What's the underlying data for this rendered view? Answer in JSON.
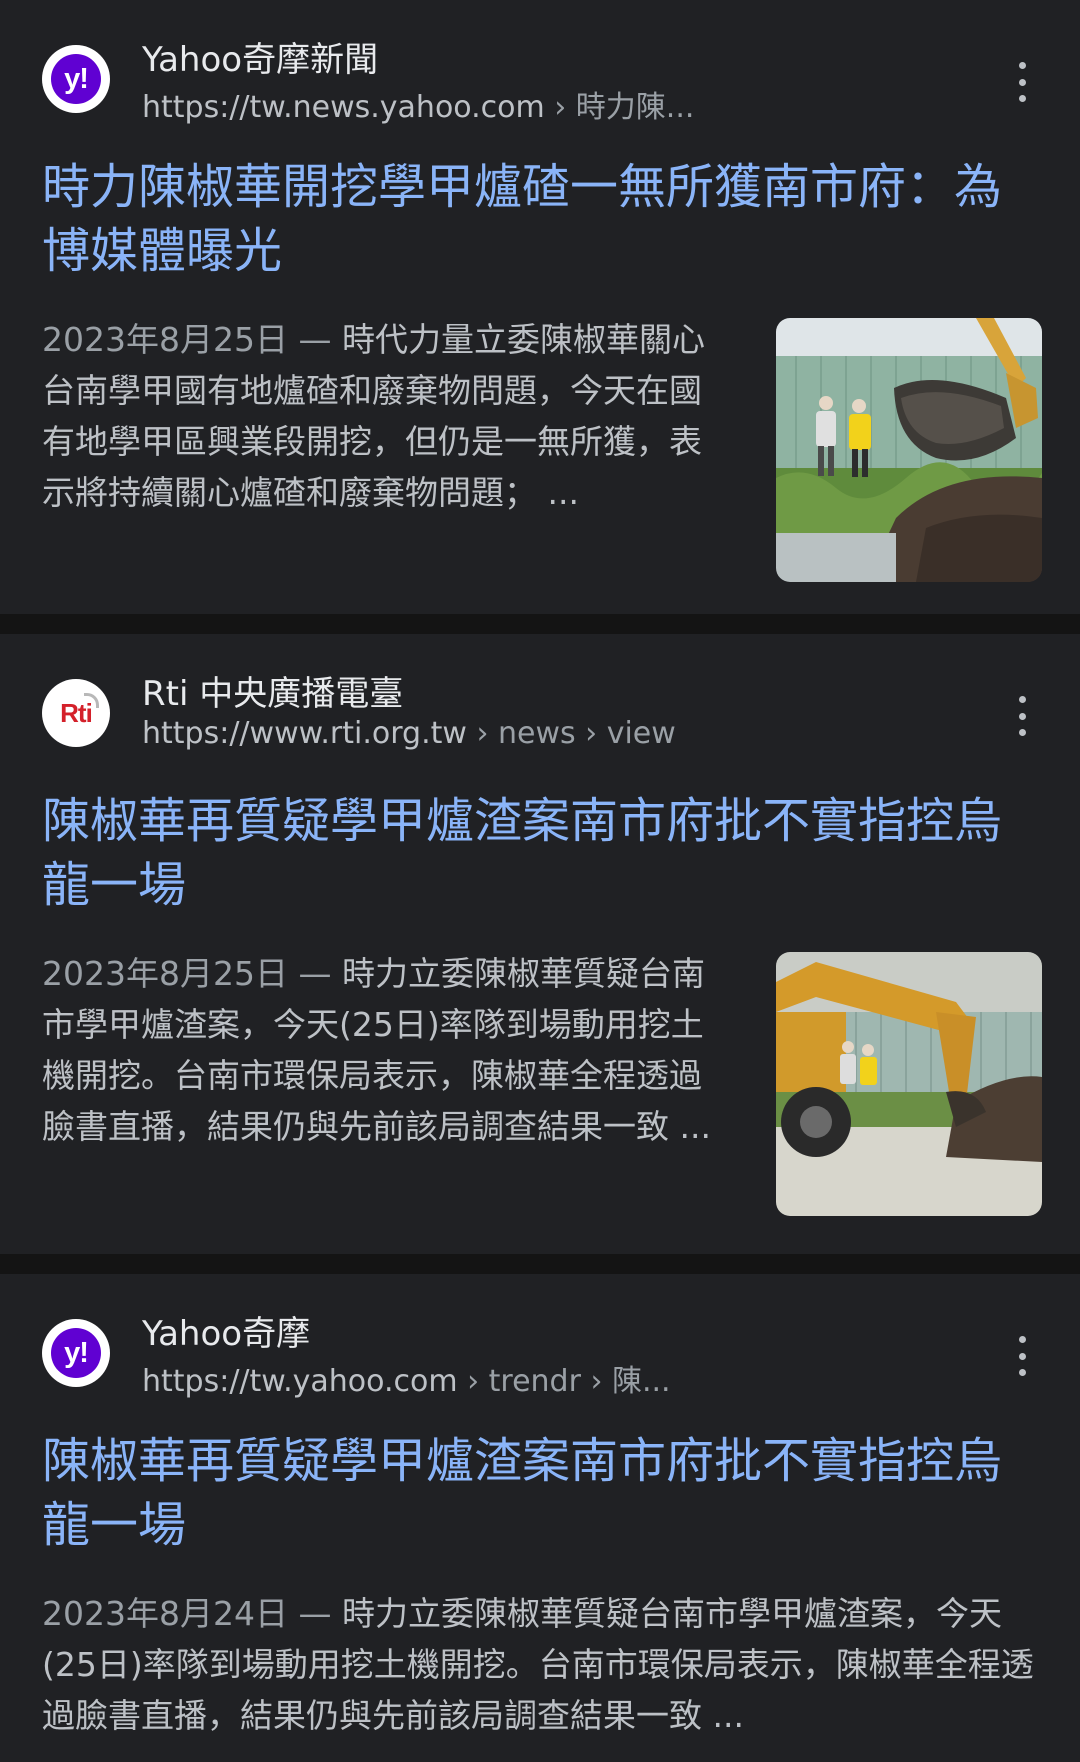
{
  "results": [
    {
      "site_name": "Yahoo奇摩新聞",
      "url_domain": "https://tw.news.yahoo.com",
      "url_path": " › 時力陳...",
      "favicon_icon": "yahoo-logo-icon",
      "favicon_text": "y!",
      "title": "時力陳椒華開挖學甲爐碴一無所獲南市府：為博媒體曝光",
      "date": "2023年8月25日",
      "separator": " — ",
      "snippet": "時代力量立委陳椒華關心台南學甲國有地爐碴和廢棄物問題，今天在國有地學甲區興業段開挖，但仍是一無所獲，表示將持續關心爐碴和廢棄物問題； ..."
    },
    {
      "site_name": "Rti 中央廣播電臺",
      "url_domain": "https://www.rti.org.tw",
      "url_path": " › news › view",
      "favicon_icon": "rti-logo-icon",
      "favicon_text": "Rti",
      "title": "陳椒華再質疑學甲爐渣案南市府批不實指控烏龍一場",
      "date": "2023年8月25日",
      "separator": " — ",
      "snippet": "時力立委陳椒華質疑台南市學甲爐渣案，今天(25日)率隊到場動用挖土機開挖。台南市環保局表示，陳椒華全程透過臉書直播，結果仍與先前該局調查結果一致 ..."
    },
    {
      "site_name": "Yahoo奇摩",
      "url_domain": "https://tw.yahoo.com",
      "url_path": " › trendr › 陳...",
      "favicon_icon": "yahoo-logo-icon",
      "favicon_text": "y!",
      "title": "陳椒華再質疑學甲爐渣案南市府批不實指控烏龍一場",
      "date": "2023年8月24日",
      "separator": " — ",
      "snippet": "時力立委陳椒華質疑台南市學甲爐渣案，今天(25日)率隊到場動用挖土機開挖。台南市環保局表示，陳椒華全程透過臉書直播，結果仍與先前該局調查結果一致 ..."
    }
  ],
  "colors": {
    "background": "#202124",
    "divider": "#141414",
    "title_link": "#8ab4f8",
    "text": "#bdc1c6",
    "yahoo_purple": "#6001d2",
    "rti_red": "#d4202a"
  }
}
